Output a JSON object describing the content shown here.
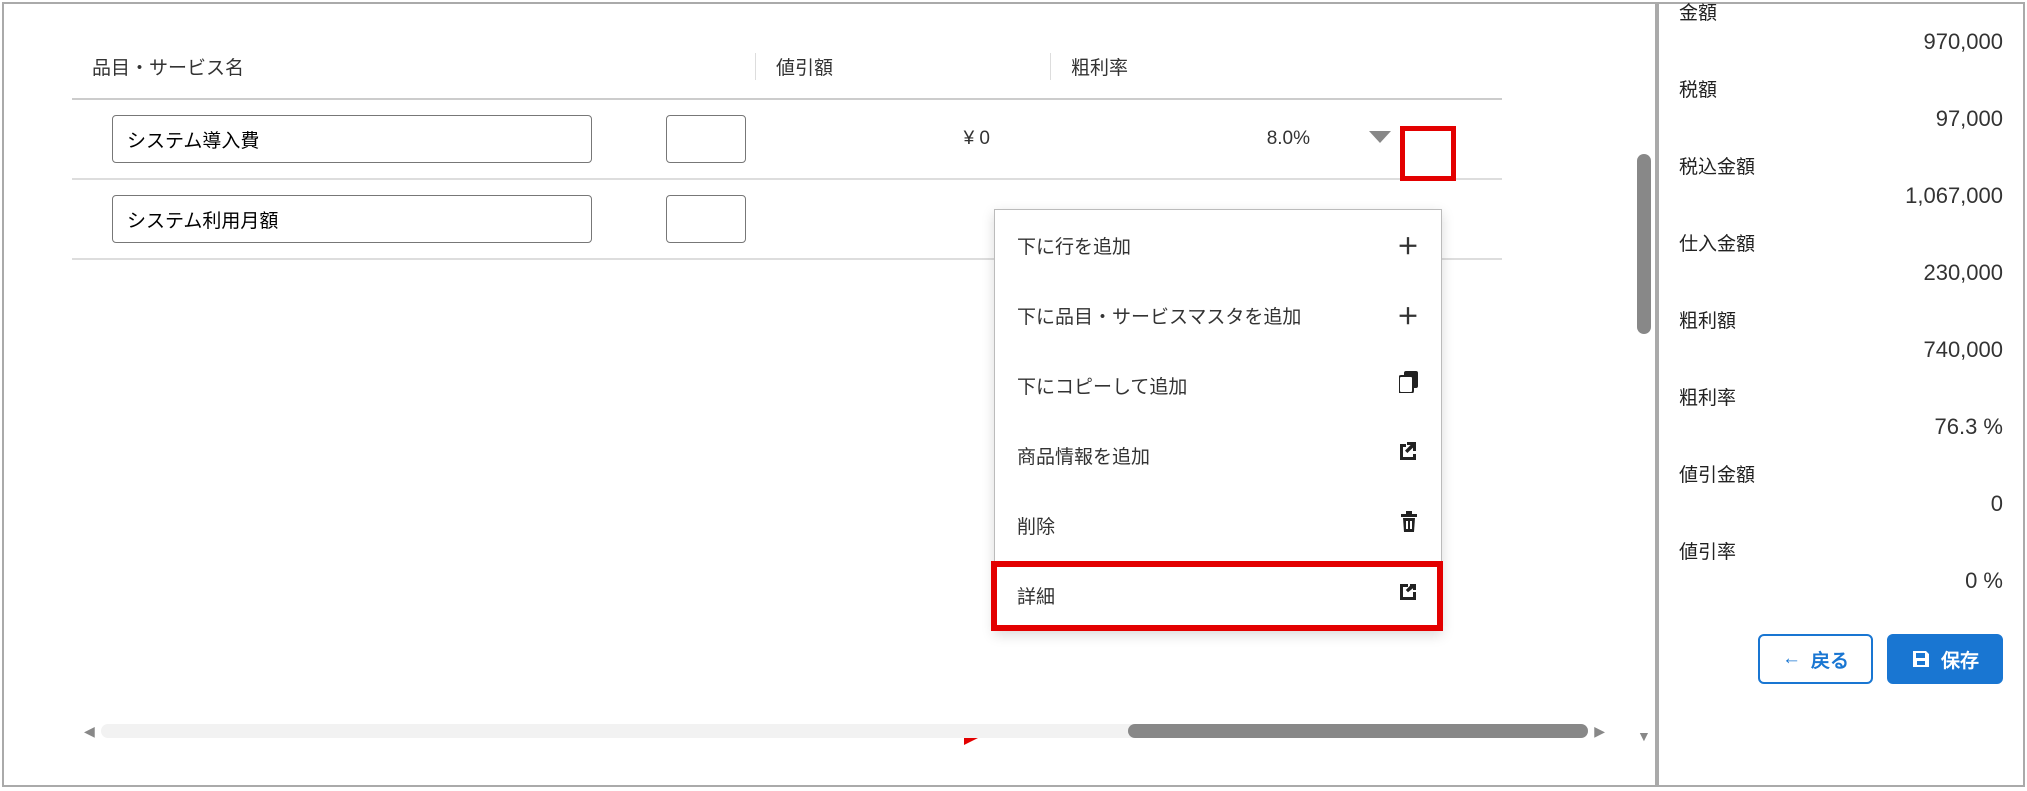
{
  "table": {
    "headers": {
      "name": "品目・サービス名",
      "discount": "値引額",
      "profit_rate": "粗利率"
    },
    "rows": [
      {
        "name": "システム導入費",
        "discount": "¥ 0",
        "profit_rate": "8.0%"
      },
      {
        "name": "システム利用月額",
        "discount": "",
        "profit_rate": ""
      }
    ]
  },
  "menu": {
    "add_row": "下に行を追加",
    "add_master": "下に品目・サービスマスタを追加",
    "copy_add": "下にコピーして追加",
    "add_product_info": "商品情報を追加",
    "delete": "削除",
    "detail": "詳細"
  },
  "summary": {
    "amount_label": "金額",
    "amount_value": "970,000",
    "tax_label": "税額",
    "tax_value": "97,000",
    "total_label": "税込金額",
    "total_value": "1,067,000",
    "cost_label": "仕入金額",
    "cost_value": "230,000",
    "profit_label": "粗利額",
    "profit_value": "740,000",
    "profit_rate_label": "粗利率",
    "profit_rate_value": "76.3 %",
    "discount_amount_label": "値引金額",
    "discount_amount_value": "0",
    "discount_rate_label": "値引率",
    "discount_rate_value": "0 %"
  },
  "buttons": {
    "back": "戻る",
    "save": "保存"
  }
}
